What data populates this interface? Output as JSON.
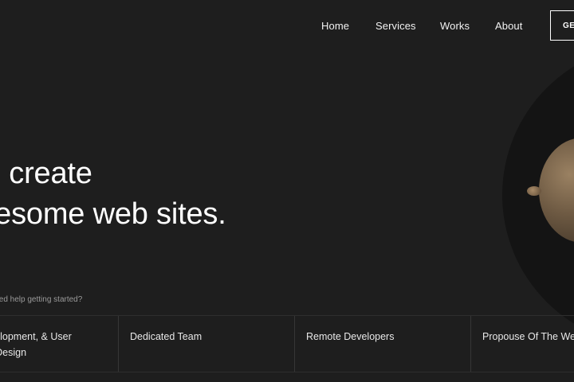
{
  "nav": {
    "items": [
      {
        "label": "Home"
      },
      {
        "label": "Services"
      },
      {
        "label": "Works"
      },
      {
        "label": "About"
      }
    ],
    "cta_label": "GET IN TOUCH"
  },
  "hero": {
    "headline_line1": "We create",
    "headline_line2": "awesome web sites.",
    "subtext": "Need help getting started?"
  },
  "features": [
    {
      "line1": "Web Development, & User",
      "line2": "Interface Design"
    },
    {
      "line1": "Dedicated Team"
    },
    {
      "line1": "Remote Developers"
    },
    {
      "line1": "Propouse Of The Website"
    }
  ],
  "colors": {
    "background": "#1e1e1e",
    "circle": "#141414",
    "orb": "#6e5a43",
    "text": "#ffffff",
    "muted": "#9a9a9a"
  }
}
